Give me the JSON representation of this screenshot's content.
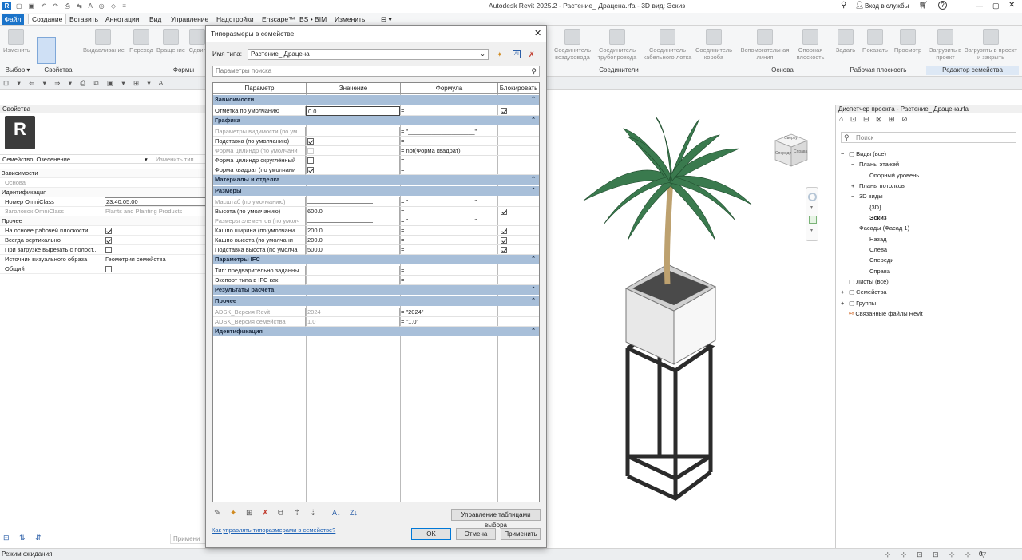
{
  "app": {
    "title": "Autodesk Revit 2025.2 - Растение_ Драцена.rfa - 3D вид: Эскиз",
    "signin": "Вход в службы",
    "help": "?"
  },
  "tabs": [
    "Файл",
    "Создание",
    "Вставить",
    "Аннотации",
    "Вид",
    "Управление",
    "Надстройки",
    "Enscape™",
    "BS • BIM",
    "Изменить"
  ],
  "ribbon": {
    "buttons_left": [
      "Изменить",
      "Выдавливание",
      "Переход",
      "Вращение",
      "Сдвиг"
    ],
    "buttons_right": [
      "Соединитель воздуховода",
      "Соединитель трубопровода",
      "Соединитель кабельного лотка",
      "Соединитель короба",
      "Вспомогательная линия",
      "Опорная плоскость",
      "Задать",
      "Показать",
      "Просмотр",
      "Загрузить в проект",
      "Загрузить в проект и закрыть"
    ],
    "panels": [
      "Выбор ▾",
      "Свойства",
      "Формы",
      "Соединители",
      "Основа",
      "Рабочая плоскость",
      "Редактор семейства"
    ]
  },
  "properties": {
    "header": "Свойства",
    "family_label": "Семейство: Озеленение",
    "edit_type": "Изменить тип",
    "rows": [
      {
        "name": "Зависимости",
        "group": true
      },
      {
        "name": "Основа",
        "value": "",
        "disabled": true
      },
      {
        "name": "Идентификация",
        "group": true
      },
      {
        "name": "Номер OmniClass",
        "value": "23.40.05.00"
      },
      {
        "name": "Заголовок OmniClass",
        "value": "Plants and Planting Products",
        "disabled": true
      },
      {
        "name": "Прочее",
        "group": true
      },
      {
        "name": "На основе рабочей плоскости",
        "check": true
      },
      {
        "name": "Всегда вертикально",
        "check": true
      },
      {
        "name": "При загрузке вырезать с полост...",
        "check": false
      },
      {
        "name": "Источник визуального образа",
        "value": "Геометрия семейства"
      },
      {
        "name": "Общий",
        "check": false
      }
    ],
    "apply_label": "Примени"
  },
  "browser": {
    "header": "Диспетчер проекта - Растение_ Драцена.rfa",
    "search": "Поиск",
    "items": [
      "Виды (все)",
      "Планы этажей",
      "Опорный уровень",
      "Планы потолков",
      "3D виды",
      "{3D}",
      "Эскиз",
      "Фасады (Фасад 1)",
      "Назад",
      "Слева",
      "Спереди",
      "Справа",
      "Листы (все)",
      "Семейства",
      "Группы",
      "Связанные файлы Revit"
    ]
  },
  "viewcube": [
    "Спереди",
    "Справа",
    "Сверху"
  ],
  "status": {
    "text": "Режим ожидания",
    "coord": "0"
  },
  "dialog": {
    "title": "Типоразмеры в семействе",
    "type_name_label": "Имя типа:",
    "type_name": "Растение_ Драцена",
    "search_placeholder": "Параметры поиска",
    "columns": [
      "Параметр",
      "Значение",
      "Формула",
      "Блокировать"
    ],
    "rows": [
      {
        "g": "Зависимости"
      },
      {
        "p": "Отметка по умолчанию",
        "v": "0.0",
        "f": "=",
        "l": true
      },
      {
        "g": "Графика"
      },
      {
        "p": "Параметры видимости (по ум",
        "v": "",
        "f": "= \"____________________\"",
        "d": true
      },
      {
        "p": "Подставка (по умолчанию)",
        "v": "chk",
        "f": "="
      },
      {
        "p": "Форма цилиндр (по умолчани",
        "v": "nochk",
        "f": "= not(Форма квадрат)",
        "d": true
      },
      {
        "p": "Форма цилиндр скруглённый",
        "v": "nochk",
        "f": "="
      },
      {
        "p": "Форма квадрат (по умолчани",
        "v": "chk",
        "f": "="
      },
      {
        "g": "Материалы и отделка"
      },
      {
        "g": "Размеры"
      },
      {
        "p": "Масштаб (по умолчанию)",
        "v": "",
        "f": "= \"____________________\"",
        "d": true
      },
      {
        "p": "Высота (по умолчанию)",
        "v": "600.0",
        "f": "=",
        "l": true
      },
      {
        "p": "Размеры элементов (по умолч",
        "v": "",
        "f": "= \"____________________\"",
        "d": true
      },
      {
        "p": "Кашпо ширина (по умолчани",
        "v": "200.0",
        "f": "=",
        "l": true
      },
      {
        "p": "Кашпо высота (по умолчани",
        "v": "200.0",
        "f": "=",
        "l": true
      },
      {
        "p": "Подставка высота (по умолча",
        "v": "500.0",
        "f": "=",
        "l": true
      },
      {
        "g": "Параметры IFC"
      },
      {
        "p": "Тип: предварительно заданны",
        "v": "",
        "f": "="
      },
      {
        "p": "Экспорт типа в IFC как",
        "v": "",
        "f": "="
      },
      {
        "g": "Результаты расчета"
      },
      {
        "g": "Прочее"
      },
      {
        "p": "ADSK_Версия Revit",
        "v": "2024",
        "f": "= \"2024\"",
        "d": true
      },
      {
        "p": "ADSK_Версия семейства",
        "v": "1.0",
        "f": "= \"1.0\"",
        "d": true
      },
      {
        "g": "Идентификация"
      }
    ],
    "lookup_btn": "Управление таблицами выбора",
    "help_link": "Как управлять типоразмерами в семействе?",
    "ok": "OK",
    "cancel": "Отмена",
    "apply": "Применить"
  }
}
